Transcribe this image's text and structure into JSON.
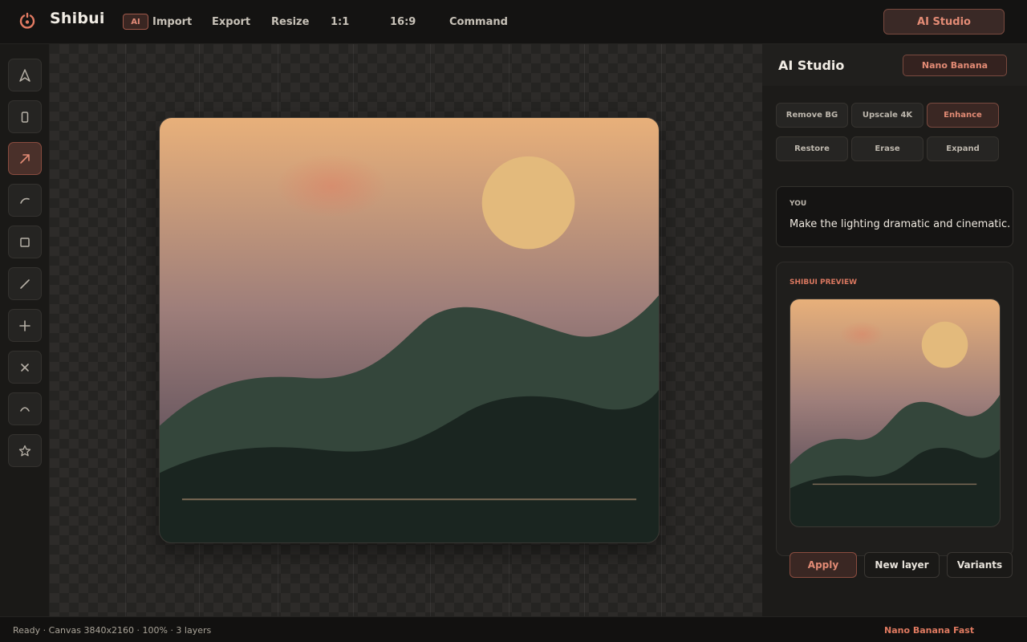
{
  "app": {
    "title": "Shibui",
    "ai_badge": "AI"
  },
  "menu": {
    "import": "Import",
    "export": "Export",
    "resize": "Resize",
    "ratio_1_1": "1:1",
    "ratio_16_9": "16:9",
    "command": "Command",
    "ai_studio": "AI Studio"
  },
  "tools": [
    {
      "name": "select-tool",
      "icon": "navigation-arrow-icon",
      "active": false
    },
    {
      "name": "frame-tool",
      "icon": "rectangle-portrait-icon",
      "active": false
    },
    {
      "name": "arrow-tool",
      "icon": "arrow-up-right-icon",
      "active": true
    },
    {
      "name": "curve-tool",
      "icon": "curve-icon",
      "active": false
    },
    {
      "name": "rectangle-tool",
      "icon": "square-icon",
      "active": false
    },
    {
      "name": "line-tool",
      "icon": "line-icon",
      "active": false
    },
    {
      "name": "add-tool",
      "icon": "plus-icon",
      "active": false
    },
    {
      "name": "delete-tool",
      "icon": "close-icon",
      "active": false
    },
    {
      "name": "arc-tool",
      "icon": "chevron-up-icon",
      "active": false
    },
    {
      "name": "favorite-tool",
      "icon": "star-icon",
      "active": false
    }
  ],
  "panel": {
    "title": "AI Studio",
    "model": "Nano Banana",
    "actions": [
      "Remove BG",
      "Upscale 4K",
      "Enhance",
      "Restore",
      "Erase",
      "Expand"
    ],
    "active_action": "Enhance",
    "message": {
      "label": "YOU",
      "text": "Make the lighting dramatic and cinematic."
    },
    "preview_label": "SHIBUI PREVIEW",
    "buttons": {
      "apply": "Apply",
      "new_layer": "New layer",
      "variants": "Variants"
    }
  },
  "status": {
    "left": "Ready · Canvas 3840x2160 · 100% · 3 layers",
    "right": "Nano Banana Fast"
  },
  "colors": {
    "accent": "#e38b75",
    "sky_top": "#e8b07a",
    "sky_bottom": "#6e5a5e",
    "sun": "#e3ba7c",
    "hill_light": "#34463b",
    "hill_dark": "#1a2520"
  }
}
